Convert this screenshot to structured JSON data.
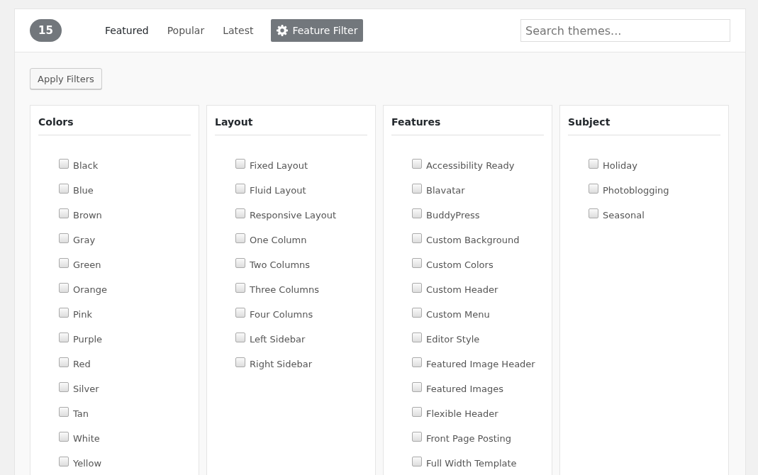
{
  "count": "15",
  "tabs": [
    {
      "label": "Featured",
      "selected": true
    },
    {
      "label": "Popular",
      "selected": false
    },
    {
      "label": "Latest",
      "selected": false
    }
  ],
  "feature_filter": {
    "label": "Feature Filter",
    "active": true
  },
  "search": {
    "placeholder": "Search themes..."
  },
  "apply_button": "Apply Filters",
  "groups": [
    {
      "title": "Colors",
      "options": [
        {
          "label": "Black",
          "checked": false
        },
        {
          "label": "Blue",
          "checked": false
        },
        {
          "label": "Brown",
          "checked": false
        },
        {
          "label": "Gray",
          "checked": false
        },
        {
          "label": "Green",
          "checked": false
        },
        {
          "label": "Orange",
          "checked": false
        },
        {
          "label": "Pink",
          "checked": false
        },
        {
          "label": "Purple",
          "checked": false
        },
        {
          "label": "Red",
          "checked": false
        },
        {
          "label": "Silver",
          "checked": false
        },
        {
          "label": "Tan",
          "checked": false
        },
        {
          "label": "White",
          "checked": false
        },
        {
          "label": "Yellow",
          "checked": false
        }
      ]
    },
    {
      "title": "Layout",
      "options": [
        {
          "label": "Fixed Layout",
          "checked": false
        },
        {
          "label": "Fluid Layout",
          "checked": false
        },
        {
          "label": "Responsive Layout",
          "checked": false
        },
        {
          "label": "One Column",
          "checked": false
        },
        {
          "label": "Two Columns",
          "checked": false
        },
        {
          "label": "Three Columns",
          "checked": false
        },
        {
          "label": "Four Columns",
          "checked": false
        },
        {
          "label": "Left Sidebar",
          "checked": false
        },
        {
          "label": "Right Sidebar",
          "checked": false
        }
      ]
    },
    {
      "title": "Features",
      "options": [
        {
          "label": "Accessibility Ready",
          "checked": false
        },
        {
          "label": "Blavatar",
          "checked": false
        },
        {
          "label": "BuddyPress",
          "checked": false
        },
        {
          "label": "Custom Background",
          "checked": false
        },
        {
          "label": "Custom Colors",
          "checked": false
        },
        {
          "label": "Custom Header",
          "checked": false
        },
        {
          "label": "Custom Menu",
          "checked": false
        },
        {
          "label": "Editor Style",
          "checked": false
        },
        {
          "label": "Featured Image Header",
          "checked": false
        },
        {
          "label": "Featured Images",
          "checked": false
        },
        {
          "label": "Flexible Header",
          "checked": false
        },
        {
          "label": "Front Page Posting",
          "checked": false
        },
        {
          "label": "Full Width Template",
          "checked": false
        }
      ]
    },
    {
      "title": "Subject",
      "options": [
        {
          "label": "Holiday",
          "checked": false
        },
        {
          "label": "Photoblogging",
          "checked": false
        },
        {
          "label": "Seasonal",
          "checked": false
        }
      ]
    }
  ]
}
